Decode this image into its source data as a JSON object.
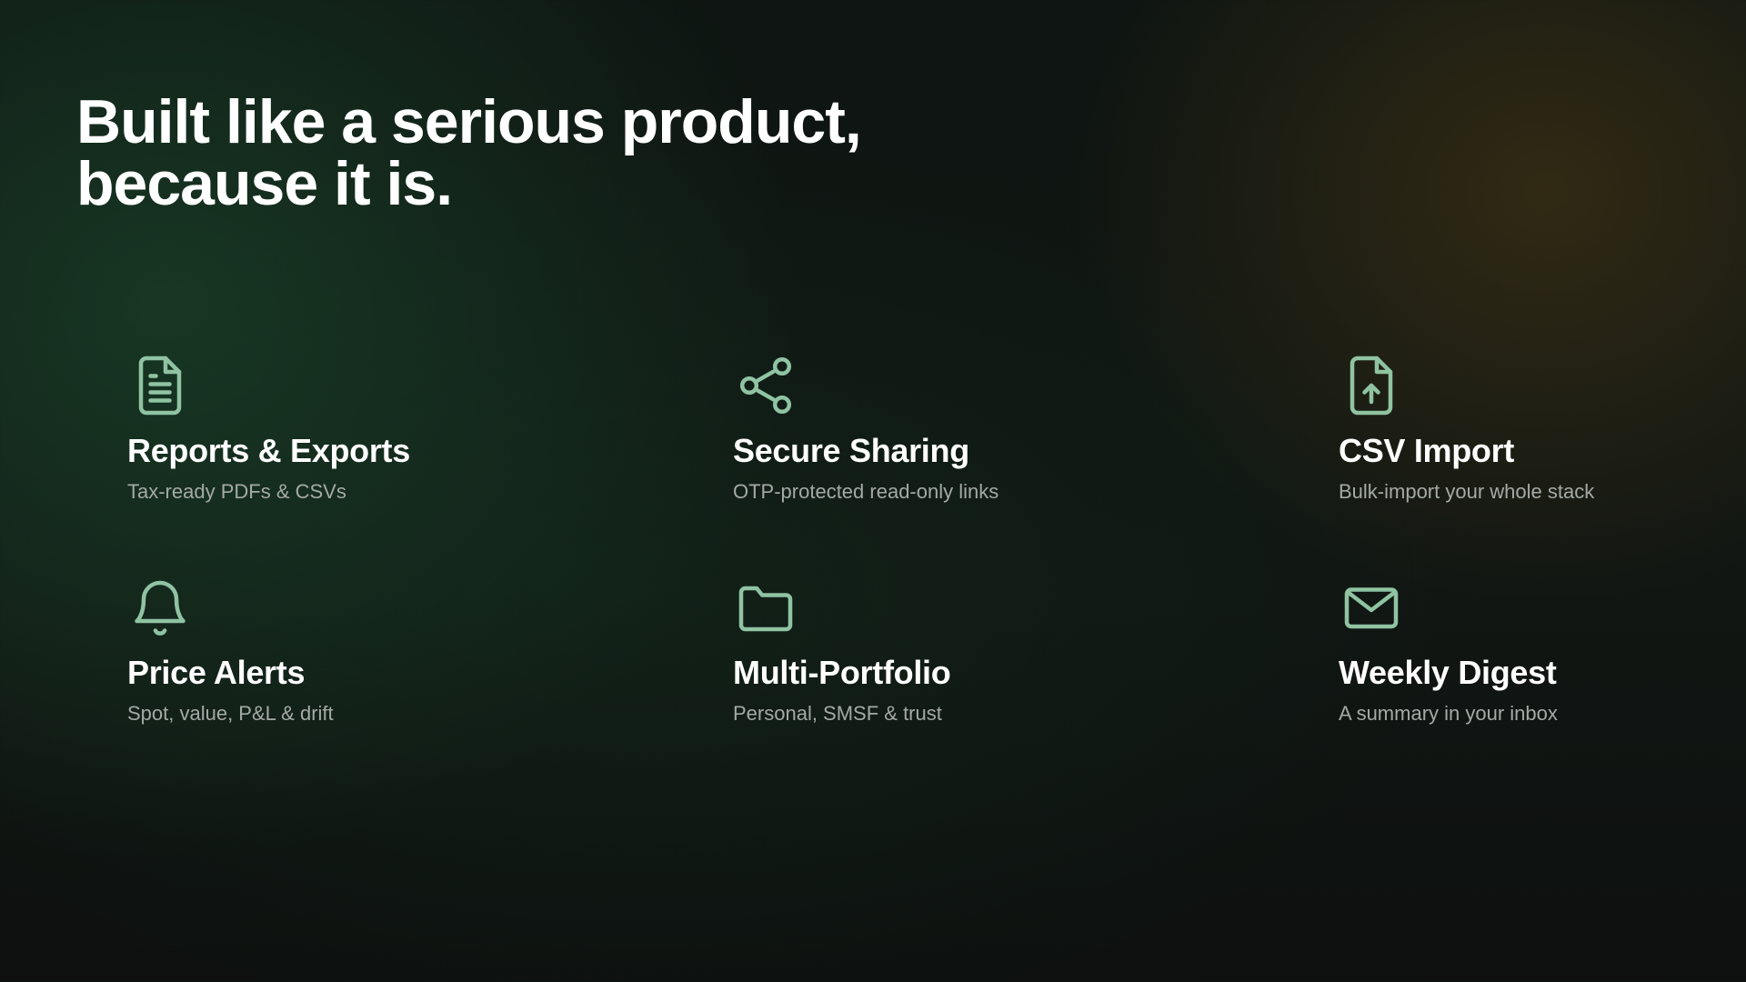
{
  "headline": {
    "line1": "Built like a serious product,",
    "line2": "because it is."
  },
  "colors": {
    "icon_stroke": "#8fc3a2",
    "title": "#ffffff",
    "description": "#a4aaa6"
  },
  "features": [
    {
      "icon": "document-icon",
      "title": "Reports & Exports",
      "description": "Tax-ready PDFs & CSVs"
    },
    {
      "icon": "share-icon",
      "title": "Secure Sharing",
      "description": "OTP-protected read-only links"
    },
    {
      "icon": "file-upload-icon",
      "title": "CSV Import",
      "description": "Bulk-import your whole stack"
    },
    {
      "icon": "bell-icon",
      "title": "Price Alerts",
      "description": "Spot, value, P&L & drift"
    },
    {
      "icon": "folder-icon",
      "title": "Multi-Portfolio",
      "description": "Personal, SMSF & trust"
    },
    {
      "icon": "mail-icon",
      "title": "Weekly Digest",
      "description": "A summary in your inbox"
    }
  ]
}
